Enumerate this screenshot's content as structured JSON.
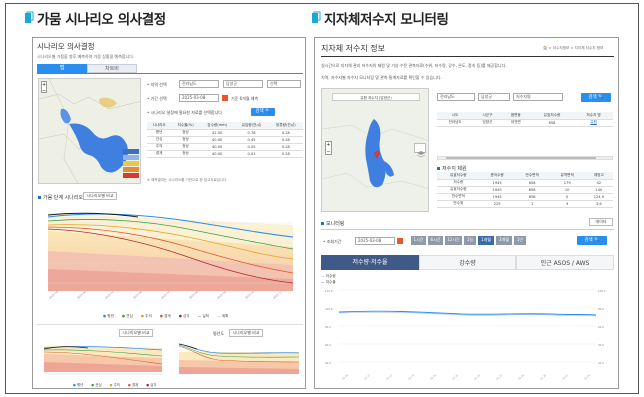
{
  "left": {
    "heading": "가뭄 시나리오 의사결정",
    "page_title": "시나리오 의사결정",
    "page_desc": "시나리오별 가뭄을 향후 예측하여 가뭄 상황을 예측합니다.",
    "tabs": [
      "맵",
      "차트비"
    ],
    "form_labels": [
      "• 지역 선택",
      "• 기간 선택",
      "• 시나리오 설정에 필요한 자료를 선택합니다"
    ],
    "selects": [
      "전라남도",
      "담양군",
      "선택"
    ],
    "date_value": "2025-03-08",
    "date_suffix": "기준 6개월 예측",
    "apply_button": "검색 🔍",
    "table_headers": [
      "시나리오",
      "저수율(%)",
      "강수량(mm)",
      "유입량(천㎥)",
      "방류량(천㎥)"
    ],
    "table_rows": [
      [
        "평년",
        "정상",
        "42.00",
        "0.78",
        "0.28"
      ],
      [
        "관심",
        "정상",
        "40.00",
        "0.45",
        "0.28"
      ],
      [
        "주의",
        "정상",
        "40.00",
        "0.05",
        "0.28"
      ],
      [
        "경계",
        "정상",
        "40.00",
        "0.01",
        "0.28"
      ]
    ],
    "note": "※ 예측결과는 시나리오를 기반으로 한 참고자료입니다",
    "chart1_title": "가뭄 단계 시나리오",
    "chart1_button": "시나리오별 비교",
    "legend": [
      "평년",
      "관심",
      "주의",
      "경계",
      "심각",
      "실적",
      "계획"
    ],
    "chart2_button": "시나리오별 비교",
    "chart3_label": "평년도",
    "chart3_button": "시나리오별 비교"
  },
  "right": {
    "heading": "지자체저수지 모니터링",
    "page_title": "지자체 저수지 정보",
    "breadcrumb": "🏠 > 저수지정보 > 지자체 저수지 정보",
    "desc1": "실시간으로 지자체 관리 저수지의 제원 및 기상·수문 관측자료(수위, 저수량, 강수, 온도, 풍속 등)를 제공합니다.",
    "desc2": "지역, 저수지별 저수지 모니터링 및 관측 통계자료를 확인할 수 있습니다.",
    "map_caption": "유원 저수지 (담양군)",
    "search_selects": [
      "전라남도",
      "담양군",
      "저수지명"
    ],
    "search_button": "검색 🔍",
    "list_headers": [
      "시도",
      "시군구",
      "읍면동",
      "유효저수량",
      "저수지 명"
    ],
    "list_row": [
      "전라남도",
      "담양군",
      "대전면",
      "658",
      "유원"
    ],
    "info_title": "저수지 제원",
    "info_headers": [
      "유효저수량",
      "총저수량",
      "만수면적",
      "유역면적",
      "제방고"
    ],
    "info_rows": [
      [
        "저수량",
        "1945",
        "658",
        "179",
        "42"
      ],
      [
        "유효저수량",
        "1945",
        "658",
        "10",
        "140"
      ],
      [
        "만수면적",
        "1945",
        "658",
        "0",
        "124.9"
      ],
      [
        "만수위",
        "225",
        "1",
        "9",
        "3.6"
      ]
    ],
    "monitor_title": "모니터링",
    "download_button": "데이터",
    "date_label": "• 조회기간",
    "date_value": "2025-03-08",
    "time_buttons": [
      "1시간",
      "6시간",
      "12시간",
      "1일",
      "1개월",
      "3개월",
      "1년"
    ],
    "query_button": "검색 🔍",
    "chart_tabs": [
      "저수량·저수율",
      "강수량",
      "인근 ASOS / AWS"
    ],
    "chart_legend": [
      "저수량",
      "저수율"
    ]
  },
  "colors": {
    "accent": "#2a8ef0",
    "navy": "#3f5a86",
    "reservoir": "#3e7fe0"
  },
  "icons": [
    "file-icon",
    "file-icon"
  ]
}
